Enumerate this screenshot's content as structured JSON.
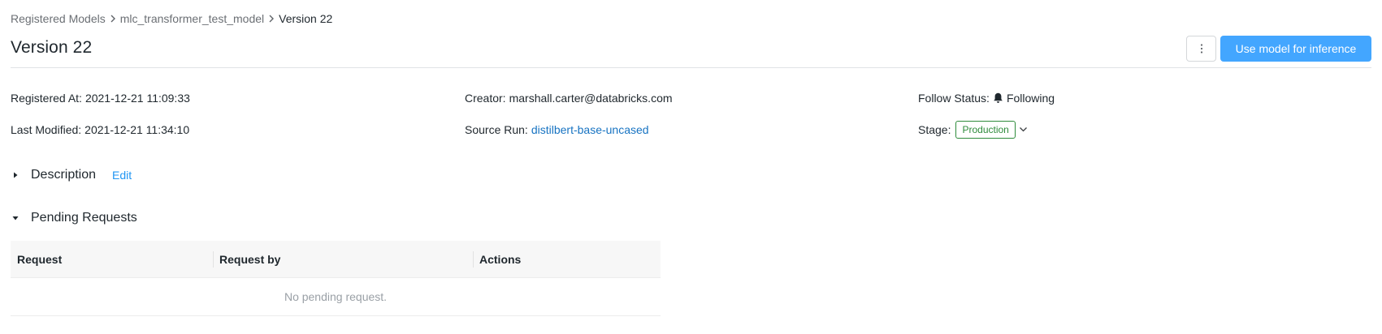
{
  "breadcrumb": {
    "items": [
      "Registered Models",
      "mlc_transformer_test_model",
      "Version 22"
    ]
  },
  "header": {
    "title": "Version 22",
    "more_icon": "vertical-ellipsis-icon",
    "primary_button_label": "Use model for inference",
    "primary_color": "#43a6ff"
  },
  "metadata": {
    "registered_at": {
      "label": "Registered At:",
      "value": "2021-12-21 11:09:33"
    },
    "last_modified": {
      "label": "Last Modified:",
      "value": "2021-12-21 11:34:10"
    },
    "creator": {
      "label": "Creator:",
      "value": "marshall.carter@databricks.com"
    },
    "source_run": {
      "label": "Source Run:",
      "value": "distilbert-base-uncased"
    },
    "follow_status": {
      "label": "Follow Status:",
      "value": "Following",
      "icon": "bell-icon"
    },
    "stage": {
      "label": "Stage:",
      "value": "Production",
      "color": "#2e8b3b",
      "icon": "chevron-down-icon"
    }
  },
  "sections": {
    "description": {
      "title": "Description",
      "edit_label": "Edit",
      "expanded": false
    },
    "pending_requests": {
      "title": "Pending Requests",
      "expanded": true
    }
  },
  "pending_table": {
    "columns": [
      "Request",
      "Request by",
      "Actions"
    ],
    "empty_text": "No pending request."
  }
}
